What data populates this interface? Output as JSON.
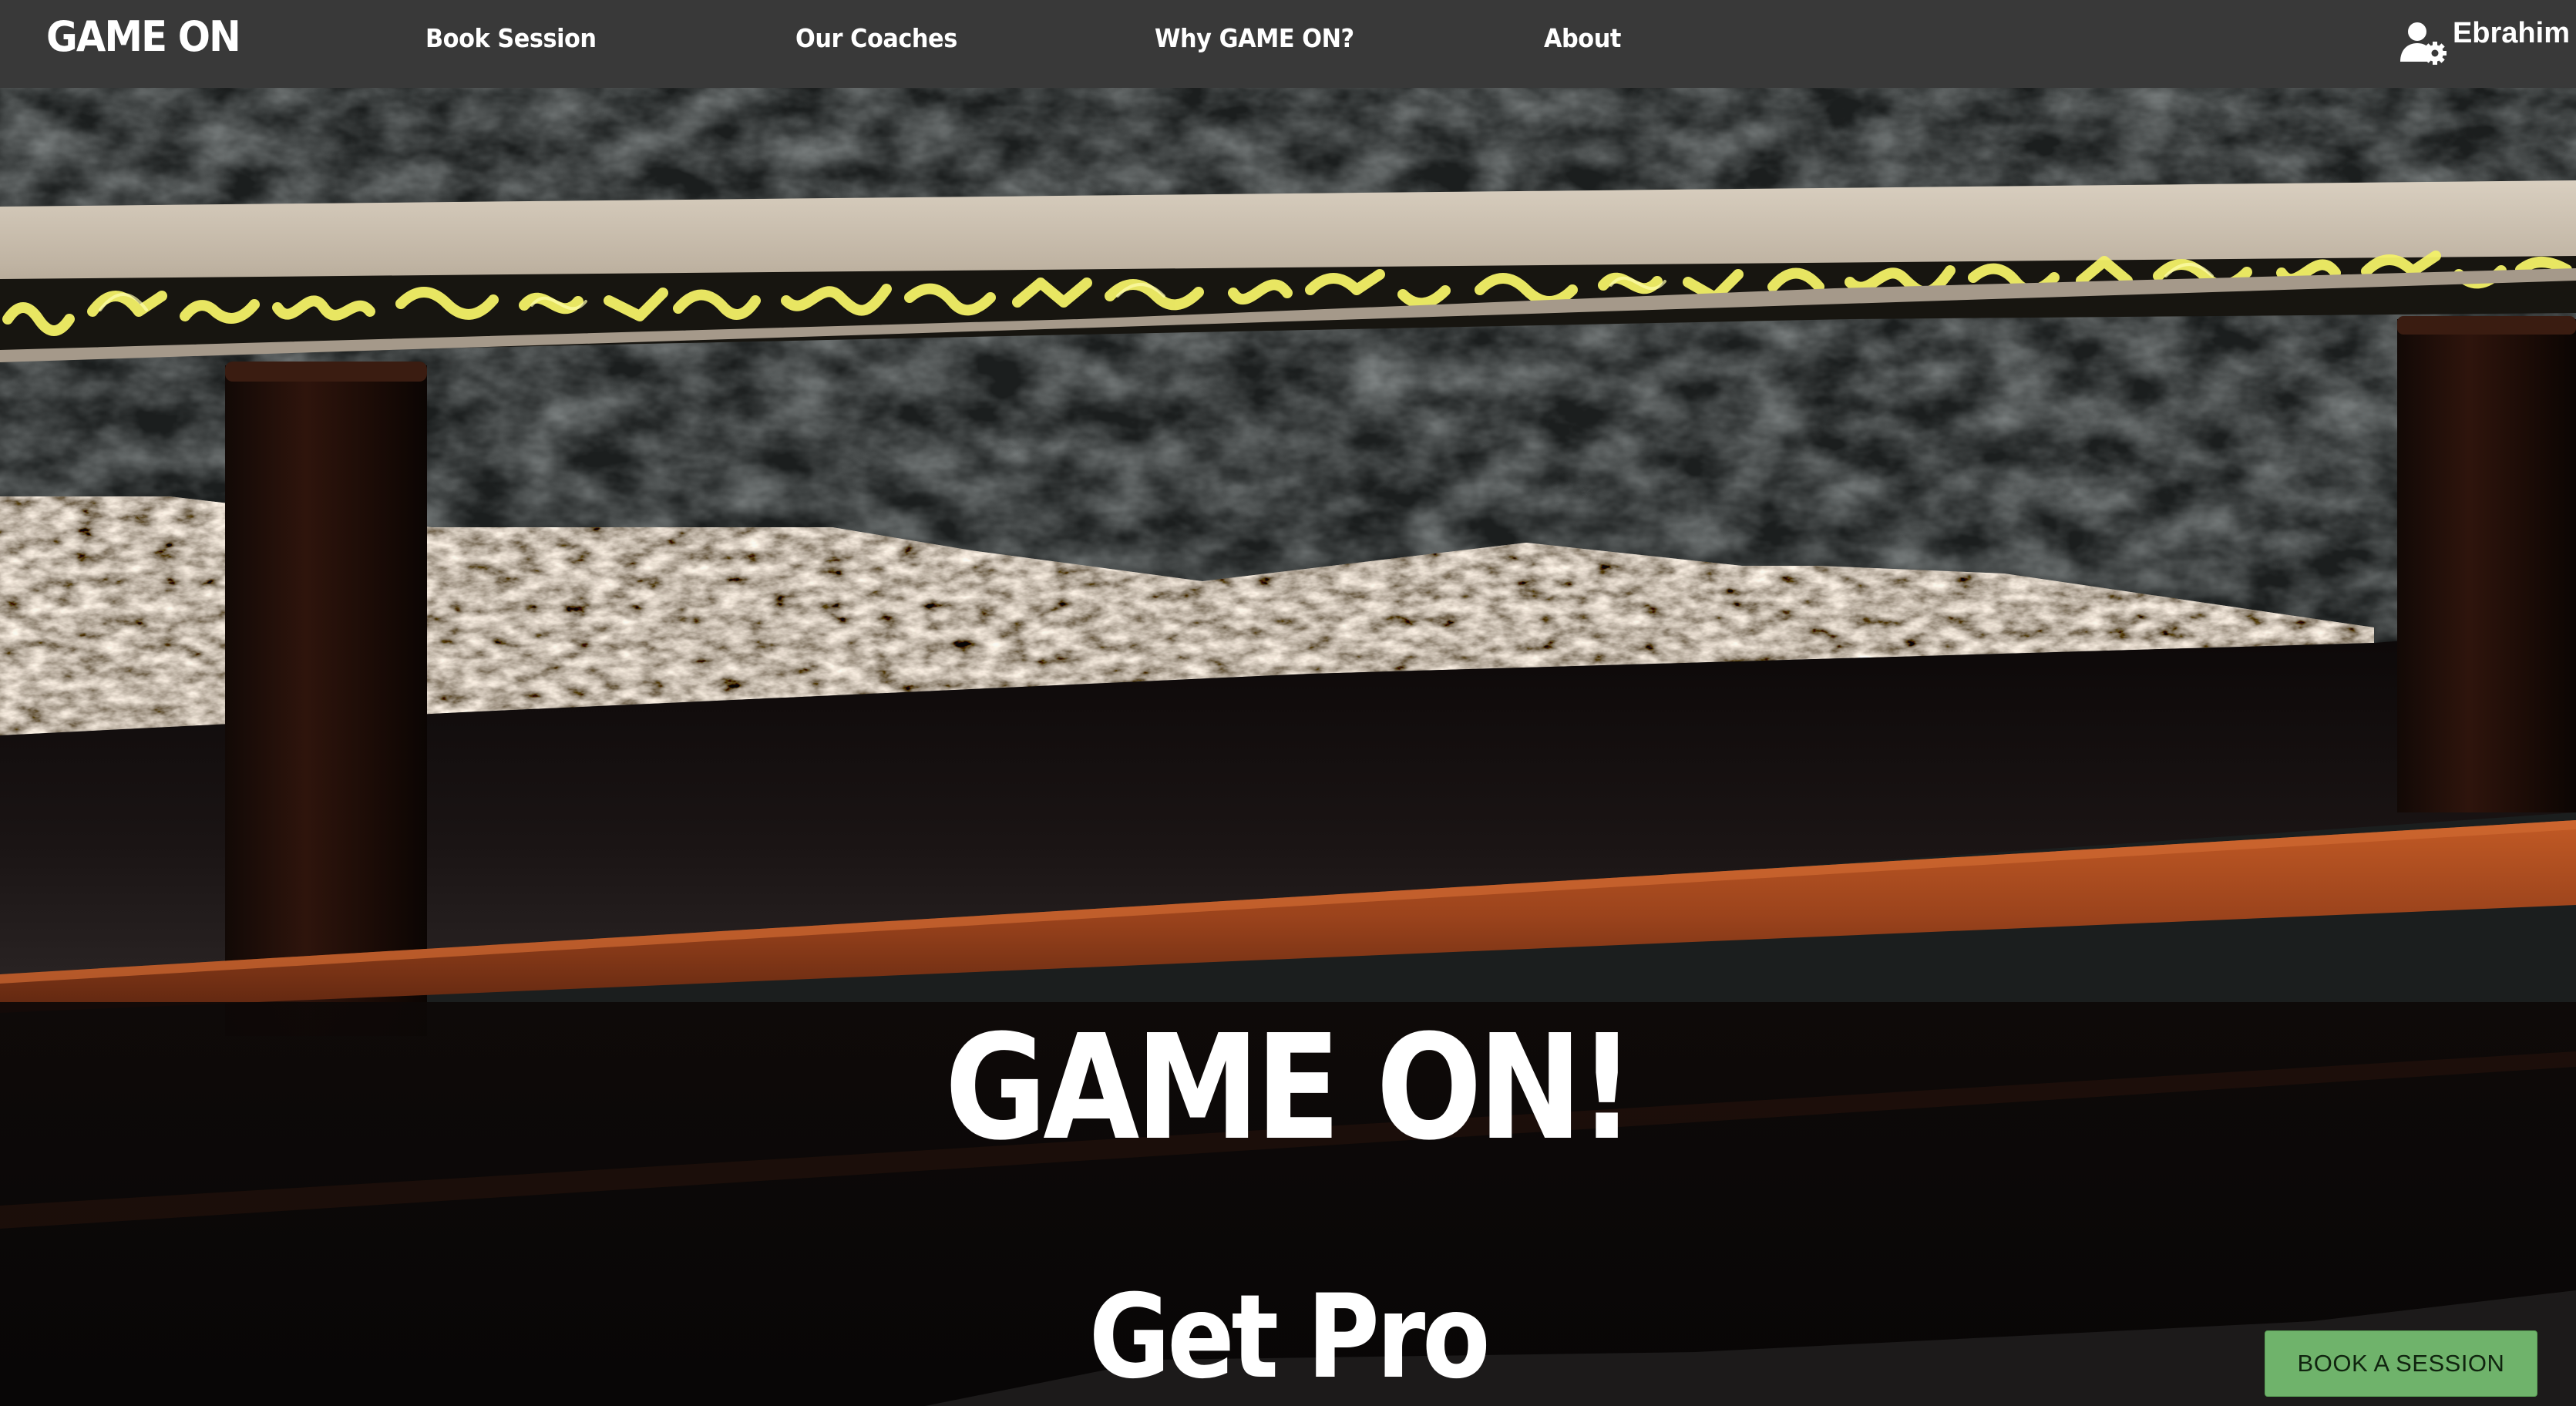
{
  "nav": {
    "brand": "GAME ON",
    "links": [
      "Book Session",
      "Our Coaches",
      "Why GAME ON?",
      "About"
    ],
    "user_name": "Ebrahim",
    "user_icon": "user-gear-icon"
  },
  "hero": {
    "title": "GAME ON!",
    "subtitle": "Get Pro",
    "cta_label": "BOOK A SESSION"
  },
  "colors": {
    "navbar": "#393939",
    "cta": "#6fb36b",
    "glow_text": "#f2f06a",
    "wood": "#a9481e"
  }
}
